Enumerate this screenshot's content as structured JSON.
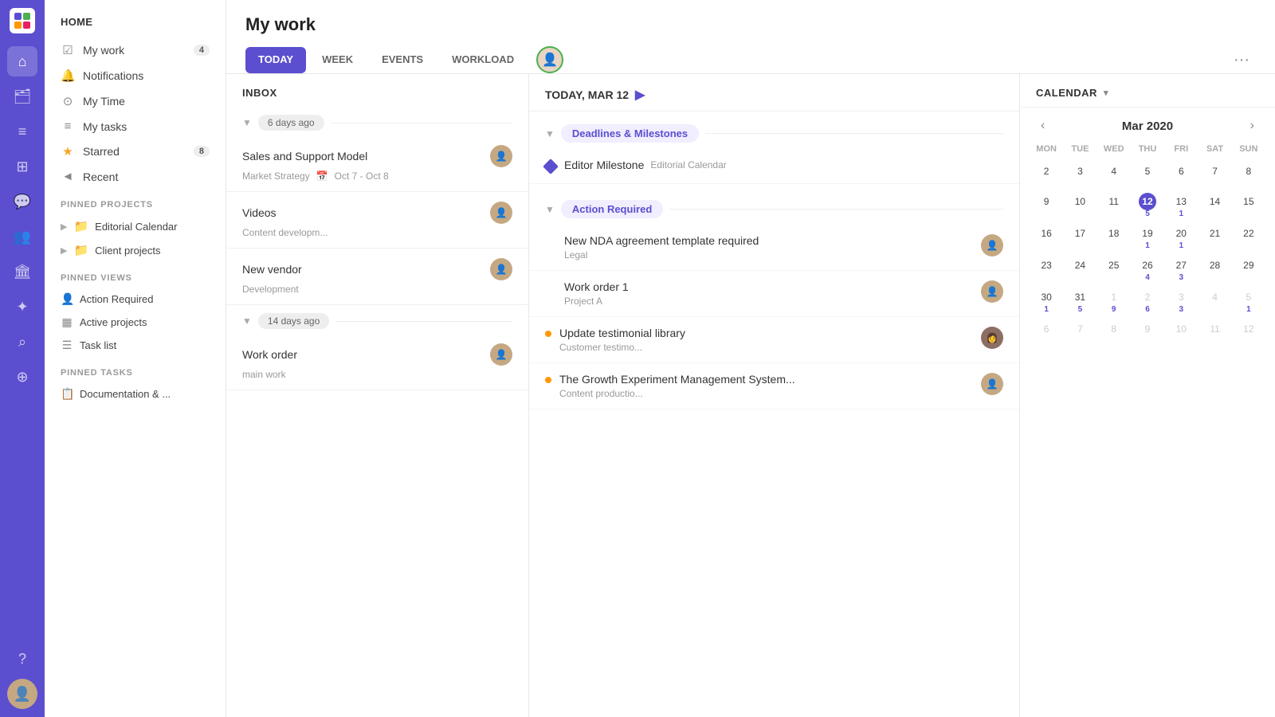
{
  "app": {
    "logo_alt": "App Logo"
  },
  "icon_sidebar": {
    "icons": [
      {
        "name": "home-icon",
        "glyph": "⌂",
        "active": true
      },
      {
        "name": "briefcase-icon",
        "glyph": "💼",
        "active": false
      },
      {
        "name": "list-icon",
        "glyph": "☰",
        "active": false
      },
      {
        "name": "grid-icon",
        "glyph": "⊞",
        "active": false
      },
      {
        "name": "chat-icon",
        "glyph": "💬",
        "active": false
      },
      {
        "name": "people-icon",
        "glyph": "👥",
        "active": false
      },
      {
        "name": "building-icon",
        "glyph": "🏛",
        "active": false
      },
      {
        "name": "wand-icon",
        "glyph": "✦",
        "active": false
      },
      {
        "name": "search-icon",
        "glyph": "⌕",
        "active": false
      },
      {
        "name": "add-icon",
        "glyph": "+",
        "active": false
      },
      {
        "name": "help-icon",
        "glyph": "?",
        "active": false,
        "bottom": true
      },
      {
        "name": "user-avatar-icon",
        "glyph": "👤",
        "active": false,
        "bottom": true
      }
    ]
  },
  "left_nav": {
    "title": "HOME",
    "main_items": [
      {
        "id": "my-work",
        "label": "My work",
        "icon": "☑",
        "badge": "4"
      },
      {
        "id": "notifications",
        "label": "Notifications",
        "icon": "🔔",
        "badge": null
      },
      {
        "id": "my-time",
        "label": "My Time",
        "icon": "⊙",
        "badge": null
      },
      {
        "id": "my-tasks",
        "label": "My tasks",
        "icon": "≡",
        "badge": null
      },
      {
        "id": "starred",
        "label": "Starred",
        "icon": "★",
        "badge": "8"
      },
      {
        "id": "recent",
        "label": "Recent",
        "icon": "◄",
        "badge": null
      }
    ],
    "pinned_projects_label": "PINNED PROJECTS",
    "pinned_projects": [
      {
        "id": "editorial-calendar",
        "label": "Editorial Calendar"
      },
      {
        "id": "client-projects",
        "label": "Client projects"
      }
    ],
    "pinned_views_label": "PINNED VIEWS",
    "pinned_views": [
      {
        "id": "action-required",
        "label": "Action Required",
        "icon": "👤"
      },
      {
        "id": "active-projects",
        "label": "Active projects",
        "icon": "▦"
      },
      {
        "id": "task-list",
        "label": "Task list",
        "icon": "☰"
      }
    ],
    "pinned_tasks_label": "PINNED TASKS",
    "pinned_tasks": [
      {
        "id": "documentation",
        "label": "Documentation & ..."
      }
    ]
  },
  "page_title": "My work",
  "tabs": [
    {
      "id": "today",
      "label": "TODAY",
      "active": true
    },
    {
      "id": "week",
      "label": "WEEK",
      "active": false
    },
    {
      "id": "events",
      "label": "EVENTS",
      "active": false
    },
    {
      "id": "workload",
      "label": "WORKLOAD",
      "active": false
    }
  ],
  "inbox": {
    "header": "INBOX",
    "groups": [
      {
        "label": "6 days ago",
        "items": [
          {
            "title": "Sales and Support Model",
            "sub": "Market Strategy",
            "date": "Oct 7 - Oct 8",
            "avatar": "👤"
          },
          {
            "title": "Videos",
            "sub": "Content developm...",
            "date": null,
            "avatar": "👤"
          },
          {
            "title": "New vendor",
            "sub": "Development",
            "date": null,
            "avatar": "👤"
          }
        ]
      },
      {
        "label": "14 days ago",
        "items": [
          {
            "title": "Work order",
            "sub": "main work",
            "date": null,
            "avatar": "👤"
          }
        ]
      }
    ]
  },
  "today": {
    "header": "TODAY, MAR 12",
    "sections": [
      {
        "label": "Deadlines & Milestones",
        "items": [
          {
            "type": "milestone",
            "title": "Editor Milestone",
            "sub": "Editorial Calendar",
            "avatar": null
          }
        ]
      },
      {
        "label": "Action Required",
        "items": [
          {
            "type": "normal",
            "title": "New NDA agreement template required",
            "sub": "Legal",
            "avatar": "👤"
          },
          {
            "type": "normal",
            "title": "Work order 1",
            "sub": "Project A",
            "avatar": "👤"
          },
          {
            "type": "orange",
            "title": "Update testimonial library",
            "sub": "Customer testimo...",
            "avatar": "👩"
          },
          {
            "type": "orange",
            "title": "The Growth Experiment Management System...",
            "sub": "Content productio...",
            "avatar": "👤"
          }
        ]
      }
    ]
  },
  "calendar": {
    "header": "CALENDAR",
    "month": "Mar 2020",
    "days": [
      "MON",
      "TUE",
      "WED",
      "THU",
      "FRI",
      "SAT",
      "SUN"
    ],
    "weeks": [
      [
        {
          "date": "2",
          "gray": false,
          "today": false,
          "badge": null
        },
        {
          "date": "3",
          "gray": false,
          "today": false,
          "badge": null
        },
        {
          "date": "4",
          "gray": false,
          "today": false,
          "badge": null
        },
        {
          "date": "5",
          "gray": false,
          "today": false,
          "badge": null
        },
        {
          "date": "6",
          "gray": false,
          "today": false,
          "badge": null
        },
        {
          "date": "7",
          "gray": false,
          "today": false,
          "badge": null
        },
        {
          "date": "8",
          "gray": false,
          "today": false,
          "badge": null
        }
      ],
      [
        {
          "date": "9",
          "gray": false,
          "today": false,
          "badge": null
        },
        {
          "date": "10",
          "gray": false,
          "today": false,
          "badge": null
        },
        {
          "date": "11",
          "gray": false,
          "today": false,
          "badge": null
        },
        {
          "date": "12",
          "gray": false,
          "today": true,
          "badge": "5"
        },
        {
          "date": "13",
          "gray": false,
          "today": false,
          "badge": "1"
        },
        {
          "date": "14",
          "gray": false,
          "today": false,
          "badge": null
        },
        {
          "date": "15",
          "gray": false,
          "today": false,
          "badge": null
        }
      ],
      [
        {
          "date": "16",
          "gray": false,
          "today": false,
          "badge": null
        },
        {
          "date": "17",
          "gray": false,
          "today": false,
          "badge": null
        },
        {
          "date": "18",
          "gray": false,
          "today": false,
          "badge": null
        },
        {
          "date": "19",
          "gray": false,
          "today": false,
          "badge": "1"
        },
        {
          "date": "20",
          "gray": false,
          "today": false,
          "badge": "1"
        },
        {
          "date": "21",
          "gray": false,
          "today": false,
          "badge": null
        },
        {
          "date": "22",
          "gray": false,
          "today": false,
          "badge": null
        }
      ],
      [
        {
          "date": "23",
          "gray": false,
          "today": false,
          "badge": null
        },
        {
          "date": "24",
          "gray": false,
          "today": false,
          "badge": null
        },
        {
          "date": "25",
          "gray": false,
          "today": false,
          "badge": null
        },
        {
          "date": "26",
          "gray": false,
          "today": false,
          "badge": "4"
        },
        {
          "date": "27",
          "gray": false,
          "today": false,
          "badge": "3"
        },
        {
          "date": "28",
          "gray": false,
          "today": false,
          "badge": null
        },
        {
          "date": "29",
          "gray": false,
          "today": false,
          "badge": null
        }
      ],
      [
        {
          "date": "30",
          "gray": false,
          "today": false,
          "badge": "1"
        },
        {
          "date": "31",
          "gray": false,
          "today": false,
          "badge": "5"
        },
        {
          "date": "1",
          "gray": true,
          "today": false,
          "badge": "9"
        },
        {
          "date": "2",
          "gray": true,
          "today": false,
          "badge": "6"
        },
        {
          "date": "3",
          "gray": true,
          "today": false,
          "badge": "3"
        },
        {
          "date": "4",
          "gray": true,
          "today": false,
          "badge": null
        },
        {
          "date": "5",
          "gray": true,
          "today": false,
          "badge": "1"
        }
      ],
      [
        {
          "date": "6",
          "gray": true,
          "today": false,
          "badge": null
        },
        {
          "date": "7",
          "gray": true,
          "today": false,
          "badge": null
        },
        {
          "date": "8",
          "gray": true,
          "today": false,
          "badge": null
        },
        {
          "date": "9",
          "gray": true,
          "today": false,
          "badge": null
        },
        {
          "date": "10",
          "gray": true,
          "today": false,
          "badge": null
        },
        {
          "date": "11",
          "gray": true,
          "today": false,
          "badge": null
        },
        {
          "date": "12",
          "gray": true,
          "today": false,
          "badge": null
        }
      ]
    ]
  }
}
